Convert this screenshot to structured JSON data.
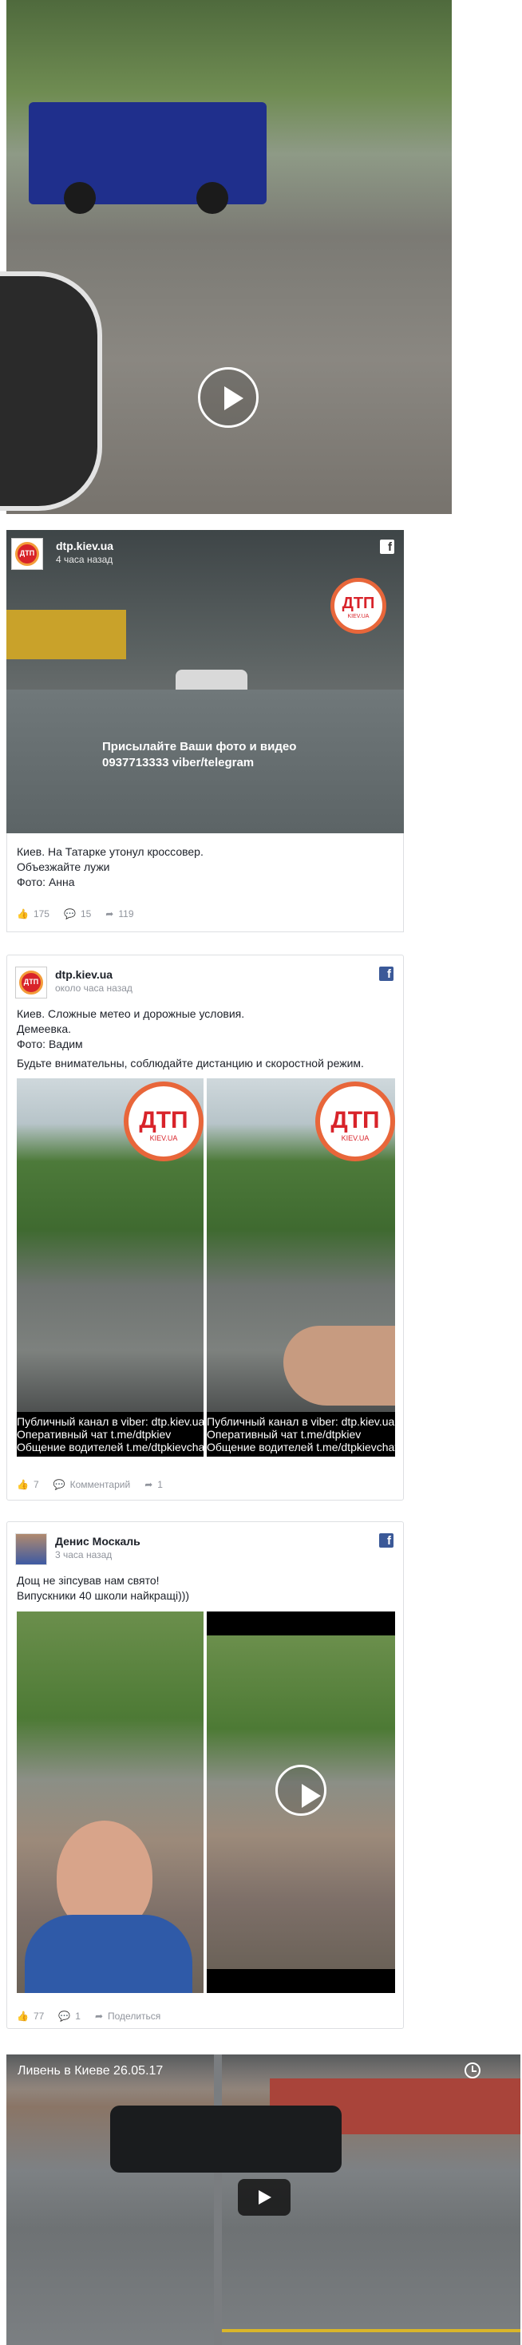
{
  "video1": {
    "play_label": "Play"
  },
  "post1": {
    "page_name": "dtp.kiev.ua",
    "time": "4 часа назад",
    "avatar_text": "ДТП",
    "logo_text": "ДТП",
    "logo_sub": "KIEV.UA",
    "overlay_line1": "Присылайте Ваши фото и видео",
    "overlay_line2": "0937713333 viber/telegram",
    "text_lines": [
      "Киев. На Татарке утонул кроссовер.",
      "Объезжайте лужи",
      "Фото: Анна"
    ],
    "likes": "175",
    "comments": "15",
    "shares": "119"
  },
  "post2": {
    "page_name": "dtp.kiev.ua",
    "time": "около часа назад",
    "avatar_text": "ДТП",
    "logo_text": "ДТП",
    "logo_sub": "KIEV.UA",
    "text_lines": [
      "Киев. Сложные метео и дорожные условия.",
      "Демеевка.",
      "Фото: Вадим"
    ],
    "text_extra": "Будьте внимательны, соблюдайте дистанцию и скоростной режим.",
    "strip_lines": [
      "Публичный канал в viber: dtp.kiev.ua",
      "Оперативный чат t.me/dtpkiev",
      "Общение водителей t.me/dtpkievchat"
    ],
    "likes": "7",
    "comments_label": "Комментарий",
    "shares": "1"
  },
  "post3": {
    "page_name": "Денис Москаль",
    "time": "3 часа назад",
    "text_lines": [
      "Дощ не зіпсував нам свято!",
      "Випускники 40 школи найкращі)))"
    ],
    "likes": "77",
    "comments": "1",
    "share_label": "Поделиться"
  },
  "video2": {
    "title": "Ливень в Киеве 26.05.17"
  }
}
